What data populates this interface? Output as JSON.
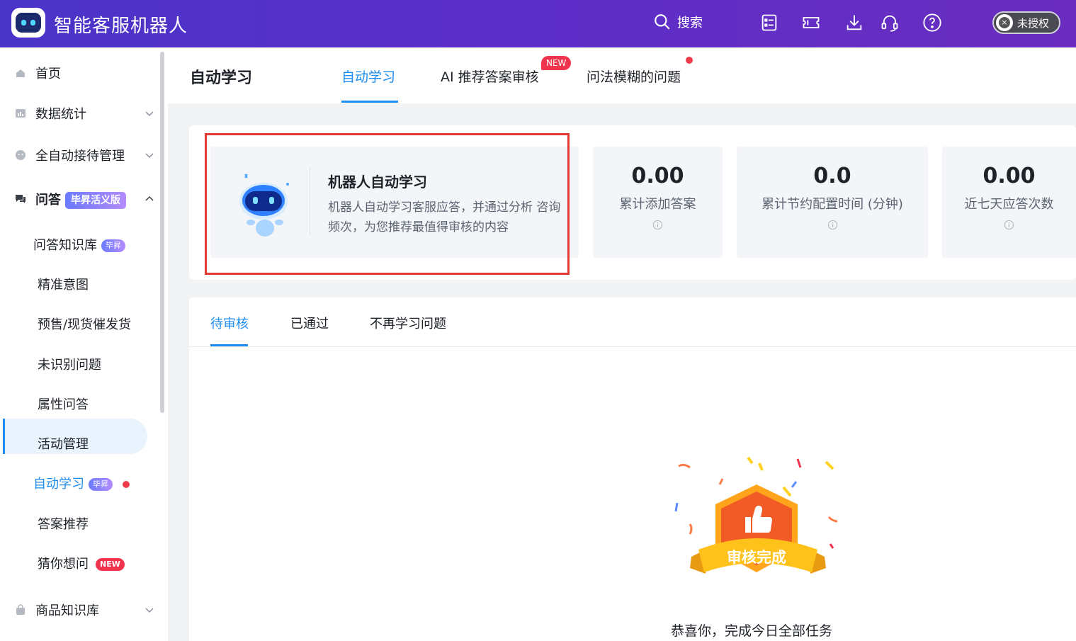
{
  "app": {
    "title": "智能客服机器人"
  },
  "topbar": {
    "search_label": "搜索",
    "auth_label": "未授权",
    "auth_icon_glyph": "×",
    "icons": [
      "list-icon",
      "ticket-icon",
      "download-icon",
      "headset-icon",
      "help-icon"
    ]
  },
  "sidebar": {
    "items": [
      {
        "label": "首页"
      },
      {
        "label": "数据统计"
      },
      {
        "label": "全自动接待管理"
      },
      {
        "label": "问答",
        "badge": "毕昇活义版"
      },
      {
        "label": "问答知识库",
        "badge": "毕昇"
      },
      {
        "label": "精准意图"
      },
      {
        "label": "预售/现货催发货"
      },
      {
        "label": "未识别问题"
      },
      {
        "label": "属性问答"
      },
      {
        "label": "活动管理"
      },
      {
        "label": "自动学习",
        "badge": "毕昇"
      },
      {
        "label": "答案推荐"
      },
      {
        "label": "猜你想问",
        "badge": "NEW"
      },
      {
        "label": "商品知识库"
      }
    ]
  },
  "header": {
    "page_title": "自动学习",
    "tabs": [
      {
        "label": "自动学习"
      },
      {
        "label": "AI 推荐答案审核",
        "badge": "NEW"
      },
      {
        "label": "问法模糊的问题"
      }
    ]
  },
  "intro": {
    "title": "机器人自动学习",
    "description": "机器人自动学习客服应答，并通过分析 咨询频次，为您推荐最值得审核的内容"
  },
  "stats": [
    {
      "value": "0.00",
      "label": "累计添加答案"
    },
    {
      "value": "0.0",
      "label": "累计节约配置时间 (分钟)"
    },
    {
      "value": "0.00",
      "label": "近七天应答次数"
    }
  ],
  "review": {
    "tabs": [
      {
        "label": "待审核"
      },
      {
        "label": "已通过"
      },
      {
        "label": "不再学习问题"
      }
    ],
    "badge_text": "审核完成",
    "empty_text": "恭喜你，完成今日全部任务"
  },
  "colors": {
    "accent": "#1c8cf0",
    "topbar": "#5b2fc9",
    "alert": "#ef3d4e"
  }
}
